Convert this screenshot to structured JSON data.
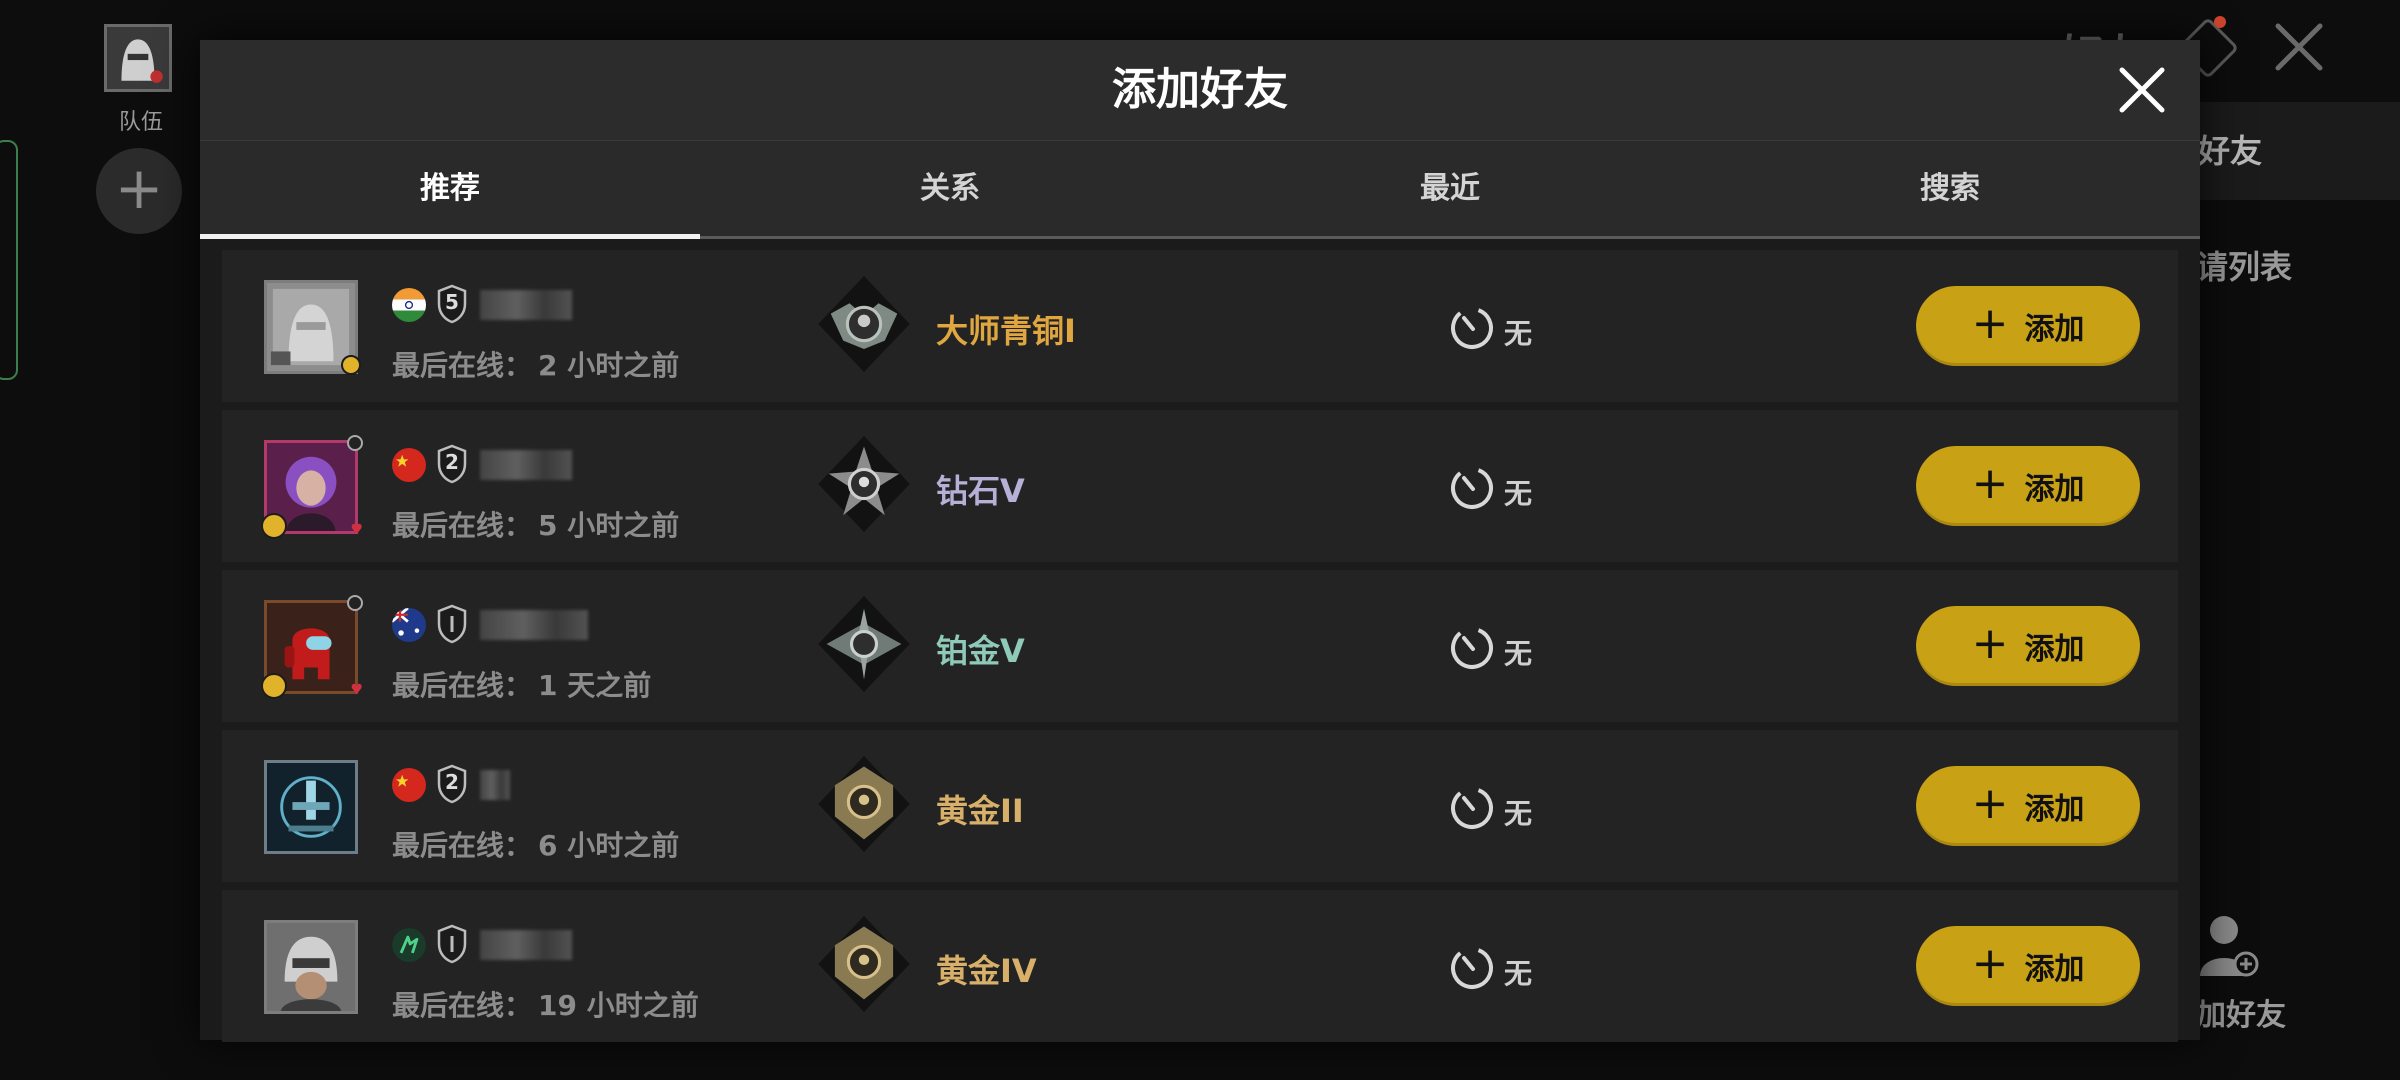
{
  "background": {
    "team_label": "队伍",
    "top_title": "好友",
    "friends_tab": "好友",
    "request_list": "请列表",
    "add_friend_label": "加好友",
    "add_glyph": "+"
  },
  "modal": {
    "title": "添加好友",
    "close_icon": "close-icon"
  },
  "tabs": [
    {
      "label": "推荐",
      "active": true
    },
    {
      "label": "关系",
      "active": false
    },
    {
      "label": "最近",
      "active": false
    },
    {
      "label": "搜索",
      "active": false
    }
  ],
  "last_online_label": "最后在线：",
  "add_button_label": "添加",
  "add_button_glyph": "+",
  "players": [
    {
      "flag": "india",
      "level": "5",
      "last_online": "2 小时之前",
      "rank": "大师青铜I",
      "rank_color": "#e0a640",
      "timer_text": "无"
    },
    {
      "flag": "china",
      "level": "2",
      "last_online": "5 小时之前",
      "rank": "钻石V",
      "rank_color": "#b6b0d6",
      "timer_text": "无"
    },
    {
      "flag": "australia",
      "level": "",
      "last_online": "1 天之前",
      "rank": "铂金V",
      "rank_color": "#8fc9b8",
      "timer_text": "无"
    },
    {
      "flag": "china",
      "level": "2",
      "last_online": "6 小时之前",
      "rank": "黄金II",
      "rank_color": "#d9b06a",
      "timer_text": "无"
    },
    {
      "flag": "green-emblem",
      "level": "",
      "last_online": "19 小时之前",
      "rank": "黄金IV",
      "rank_color": "#d9b06a",
      "timer_text": "无"
    }
  ]
}
